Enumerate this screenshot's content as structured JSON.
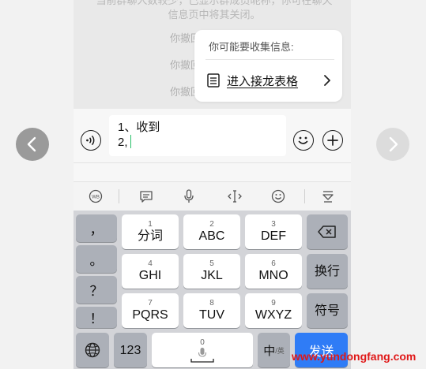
{
  "chat": {
    "system_text": "当前群聊人数较少，已显示群成员昵称，你可在聊天信息页中将其关闭。",
    "recalled": [
      "你撤回了一条消息",
      "你撤回了一条消息",
      "你撤回了一条消息"
    ]
  },
  "popup": {
    "title": "你可能要收集信息:",
    "action_label": "进入接龙表格",
    "action_icon": "list-doc-icon"
  },
  "input": {
    "lines": [
      "1、收到",
      "2,"
    ]
  },
  "keyboard": {
    "punct": [
      "，",
      "。",
      "？",
      "！"
    ],
    "keys": [
      {
        "num": "1",
        "label": "分词"
      },
      {
        "num": "2",
        "label": "ABC"
      },
      {
        "num": "3",
        "label": "DEF"
      },
      {
        "num": "4",
        "label": "GHI"
      },
      {
        "num": "5",
        "label": "JKL"
      },
      {
        "num": "6",
        "label": "MNO"
      },
      {
        "num": "7",
        "label": "PQRS"
      },
      {
        "num": "8",
        "label": "TUV"
      },
      {
        "num": "9",
        "label": "WXYZ"
      }
    ],
    "newline_label": "换行",
    "symbol_label": "符号",
    "num_switch_label": "123",
    "space_num": "0",
    "lang_main": "中",
    "lang_sub": "/英",
    "send_label": "发送"
  },
  "colors": {
    "send": "#2f7cf6",
    "caret": "#29c06a",
    "watermark": "#e01818"
  },
  "watermark": "www.yundongfang.com"
}
